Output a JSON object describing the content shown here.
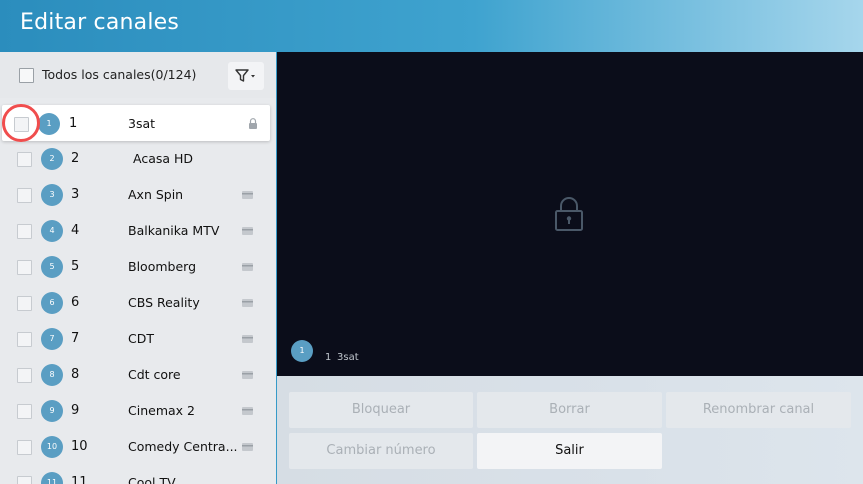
{
  "title": "Editar canales",
  "list_header": {
    "all_label": "Todos los canales(0/124)"
  },
  "channels": [
    {
      "badge": "1",
      "number": "1",
      "name": "3sat",
      "icon": "lock-icon"
    },
    {
      "badge": "2",
      "number": "2",
      "name": "Acasa HD",
      "icon": ""
    },
    {
      "badge": "3",
      "number": "3",
      "name": "Axn Spin",
      "icon": "channel-card-icon"
    },
    {
      "badge": "4",
      "number": "4",
      "name": "Balkanika MTV",
      "icon": "channel-card-icon"
    },
    {
      "badge": "5",
      "number": "5",
      "name": "Bloomberg",
      "icon": "channel-card-icon"
    },
    {
      "badge": "6",
      "number": "6",
      "name": "CBS Reality",
      "icon": "channel-card-icon"
    },
    {
      "badge": "7",
      "number": "7",
      "name": "CDT",
      "icon": "channel-card-icon"
    },
    {
      "badge": "8",
      "number": "8",
      "name": "Cdt core",
      "icon": "channel-card-icon"
    },
    {
      "badge": "9",
      "number": "9",
      "name": "Cinemax 2",
      "icon": "channel-card-icon"
    },
    {
      "badge": "10",
      "number": "10",
      "name": "Comedy Centra...",
      "icon": "channel-card-icon"
    },
    {
      "badge": "11",
      "number": "11",
      "name": "Cool TV",
      "icon": "channel-card-icon"
    }
  ],
  "preview": {
    "badge": "1",
    "number": "1",
    "name": "3sat"
  },
  "actions": {
    "lock": "Bloquear",
    "delete": "Borrar",
    "rename": "Renombrar canal",
    "change_number": "Cambiar número",
    "exit": "Salir"
  },
  "colors": {
    "accent": "#3a9fcc",
    "badge": "#5a9ec3",
    "highlight": "#f04d4d",
    "preview_bg": "#0b0d1a"
  }
}
